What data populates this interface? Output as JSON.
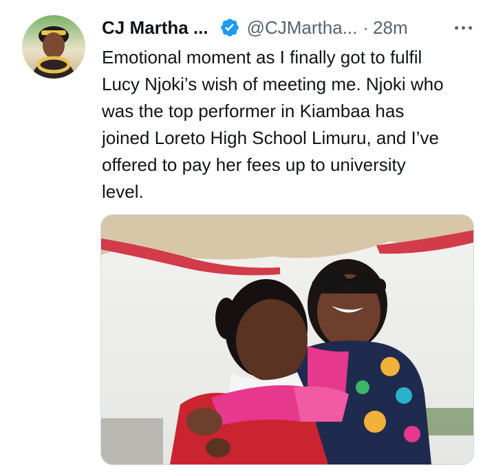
{
  "tweet": {
    "author_name": "CJ Martha ...",
    "handle": "@CJMartha...",
    "separator": "·",
    "timestamp": "28m",
    "text": "Emotional moment as I finally got to fulfil\nLucy Njoki’s wish of meeting me. Njoki who\nwas the top performer in Kiambaa has\njoined Loreto High School Limuru, and I’ve\noffered to pay her fees up to university\nlevel.",
    "verified": true,
    "icons": {
      "verified": "verified-badge-icon",
      "more": "more-options-icon"
    },
    "colors": {
      "verified": "#1d9bf0",
      "secondary_text": "#536471",
      "primary_text": "#0f1419",
      "media_border": "#cfd9de"
    }
  }
}
